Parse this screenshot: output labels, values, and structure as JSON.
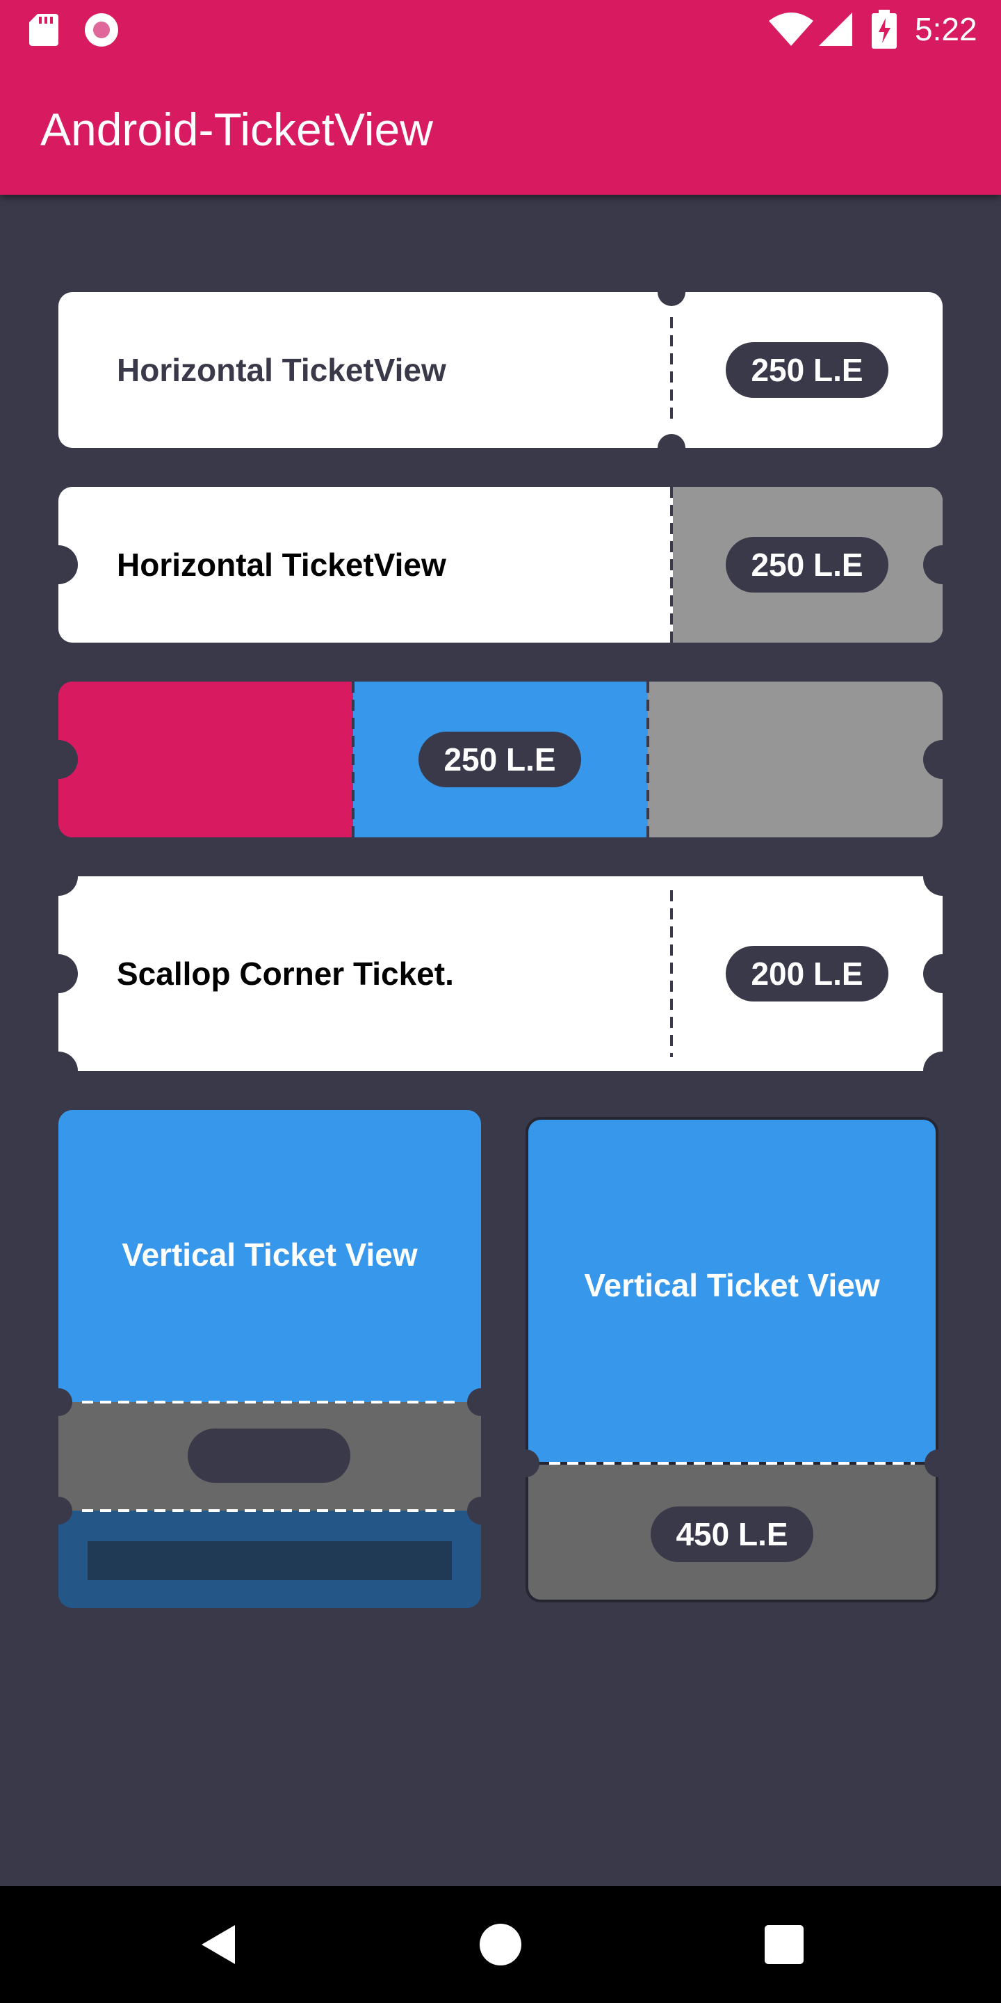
{
  "status_bar": {
    "time": "5:22",
    "icons": [
      "sd-card-icon",
      "recording-icon",
      "wifi-icon",
      "signal-icon",
      "battery-charging-icon"
    ]
  },
  "app_bar": {
    "title": "Android-TicketView"
  },
  "tickets": [
    {
      "label": "Horizontal TicketView",
      "price": "250 L.E"
    },
    {
      "label": "Horizontal TicketView",
      "price": "250 L.E"
    },
    {
      "price": "250 L.E"
    },
    {
      "label": "Scallop Corner Ticket.",
      "price": "200 L.E"
    }
  ],
  "vertical_tickets": [
    {
      "label": "Vertical Ticket View"
    },
    {
      "label": "Vertical Ticket View",
      "price": "450 L.E"
    }
  ],
  "nav_bar": {
    "icons": [
      "back-icon",
      "home-icon",
      "recents-icon"
    ]
  },
  "colors": {
    "app_bar": "#d81b60",
    "background": "#3a3949",
    "blue": "#3797eb",
    "gray": "#969696",
    "dark_gray": "#686868",
    "pink": "#d81b60"
  }
}
